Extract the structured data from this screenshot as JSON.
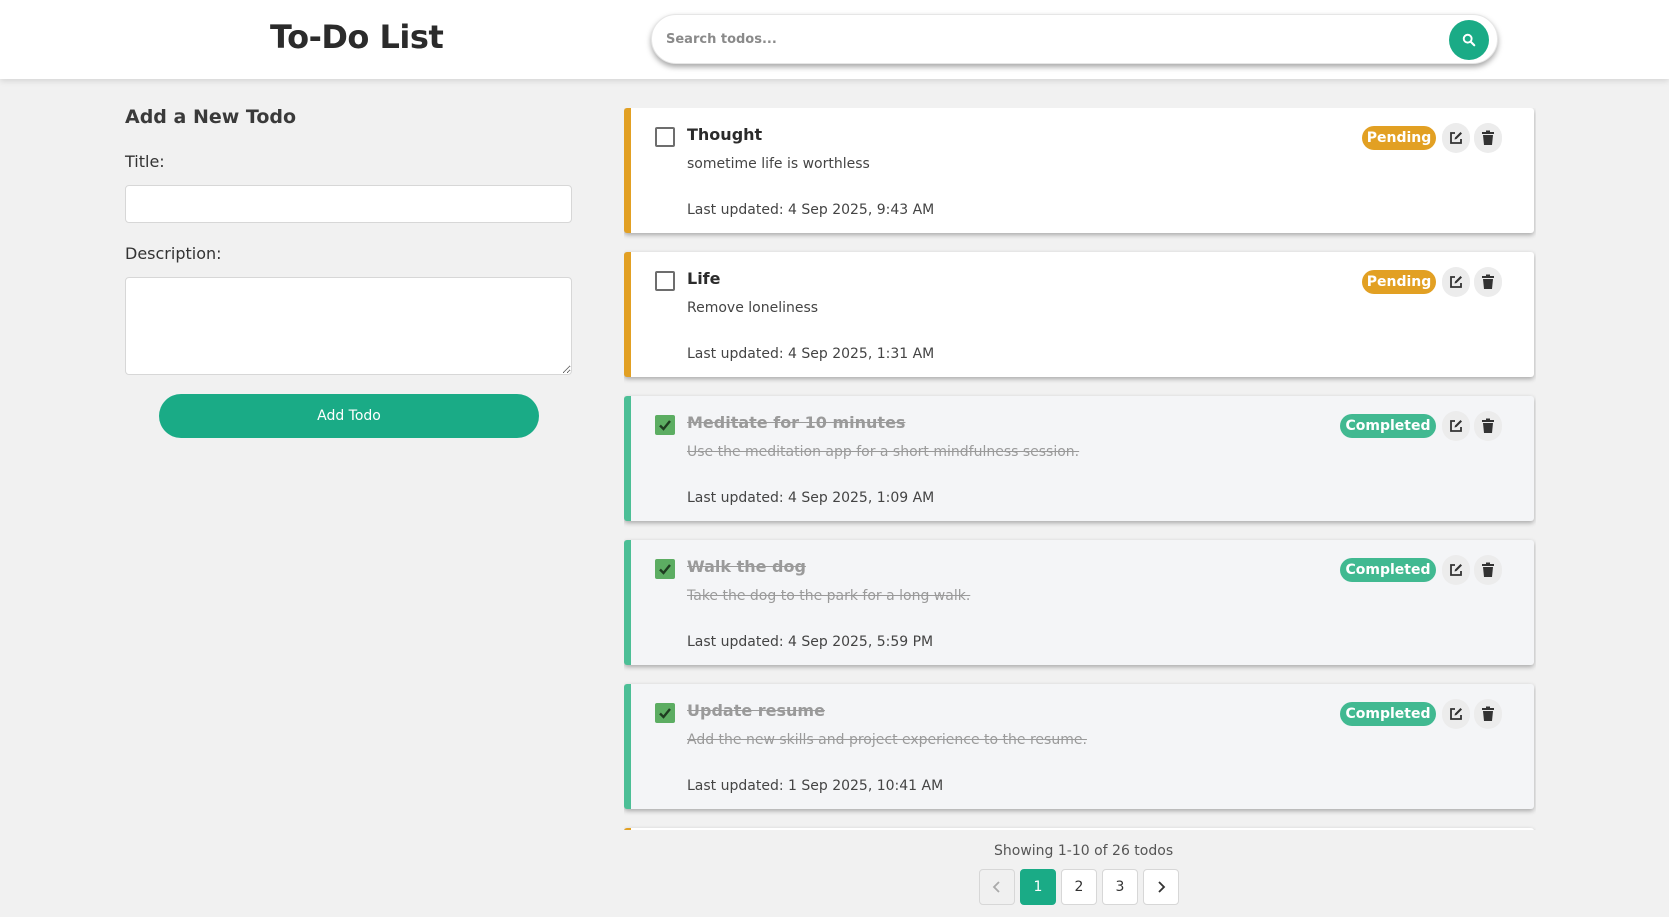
{
  "header": {
    "app_title": "To-Do List",
    "search_placeholder": "Search todos..."
  },
  "form": {
    "heading": "Add a New Todo",
    "title_label": "Title:",
    "title_value": "",
    "description_label": "Description:",
    "description_value": "",
    "submit_label": "Add Todo"
  },
  "todos": [
    {
      "title": "Thought",
      "description": "sometime life is worthless",
      "updated": "Last updated: 4 Sep 2025, 9:43 AM",
      "status": "Pending",
      "completed": false
    },
    {
      "title": "Life",
      "description": "Remove loneliness",
      "updated": "Last updated: 4 Sep 2025, 1:31 AM",
      "status": "Pending",
      "completed": false
    },
    {
      "title": "Meditate for 10 minutes",
      "description": "Use the meditation app for a short mindfulness session.",
      "updated": "Last updated: 4 Sep 2025, 1:09 AM",
      "status": "Completed",
      "completed": true
    },
    {
      "title": "Walk the dog",
      "description": "Take the dog to the park for a long walk.",
      "updated": "Last updated: 4 Sep 2025, 5:59 PM",
      "status": "Completed",
      "completed": true
    },
    {
      "title": "Update resume",
      "description": "Add the new skills and project experience to the resume.",
      "updated": "Last updated: 1 Sep 2025, 10:41 AM",
      "status": "Completed",
      "completed": true
    }
  ],
  "pagination": {
    "info": "Showing 1-10 of 26 todos",
    "pages": [
      "1",
      "2",
      "3"
    ],
    "current": "1"
  },
  "colors": {
    "accent": "#1aab86",
    "pending": "#e2a023",
    "completed": "#41b991"
  },
  "icons": {
    "search": "search-icon",
    "edit": "edit-icon",
    "delete": "trash-icon",
    "check": "check-icon",
    "prev": "chevron-left-icon",
    "next": "chevron-right-icon"
  }
}
